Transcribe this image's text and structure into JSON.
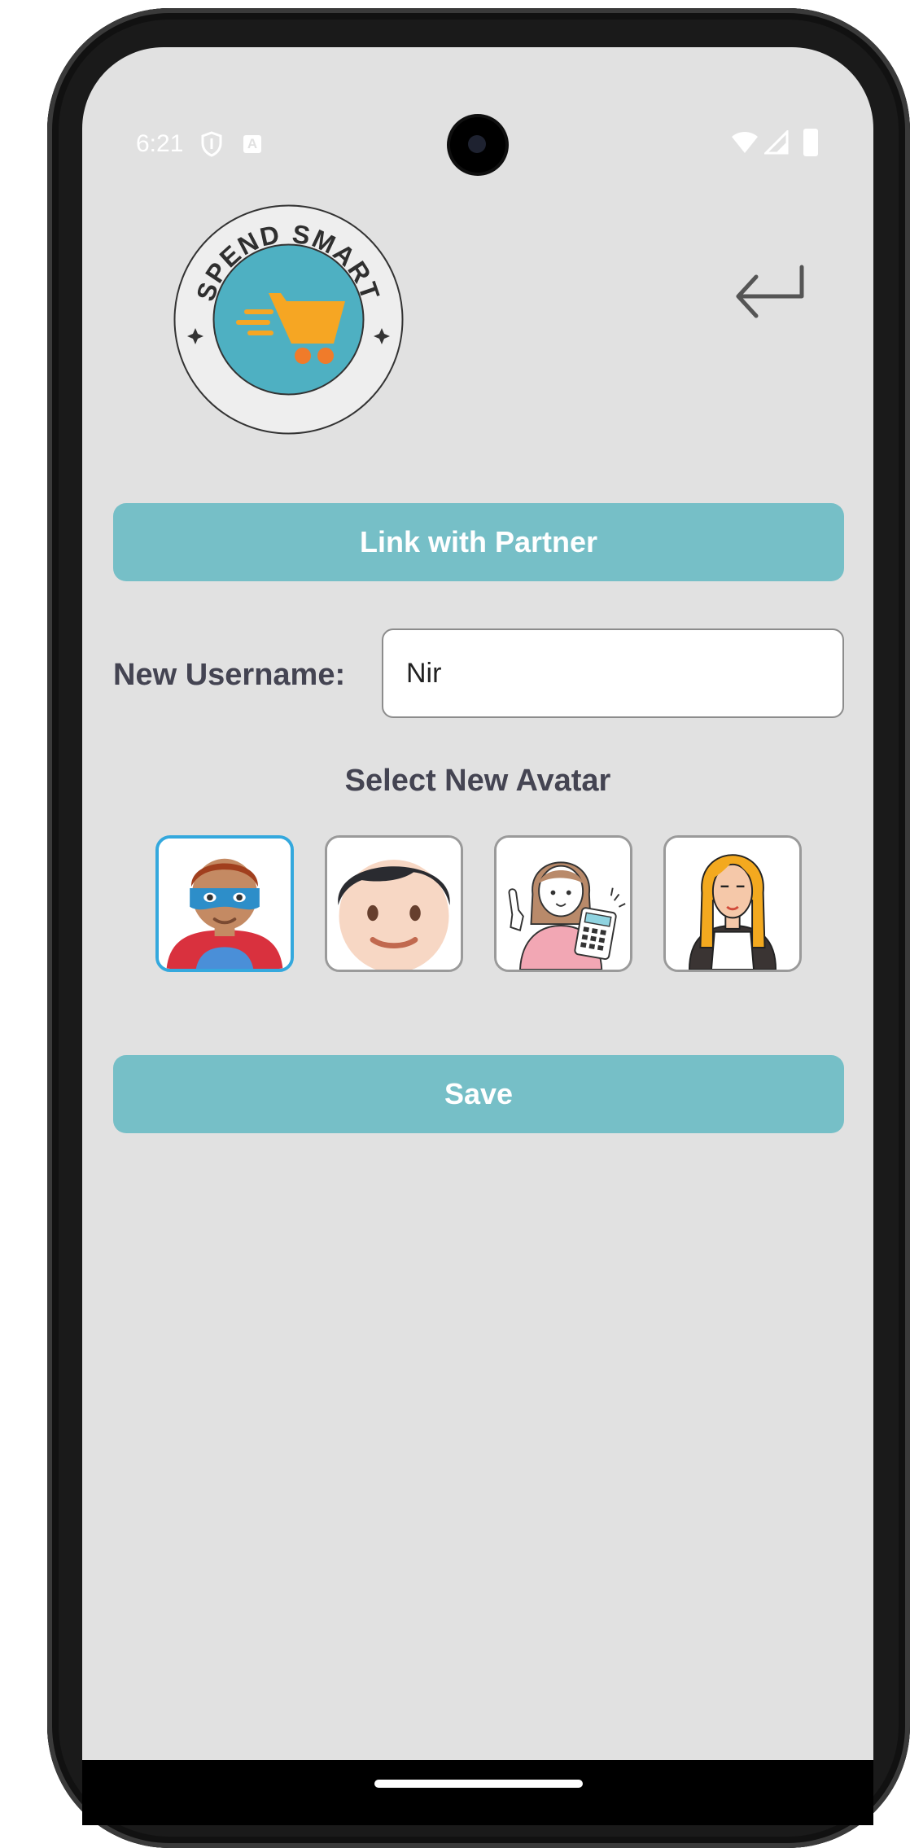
{
  "status_bar": {
    "time": "6:21",
    "notification_icons": [
      "shield-icon",
      "a-icon"
    ],
    "right_icons": [
      "wifi-icon",
      "signal-icon",
      "battery-icon"
    ]
  },
  "logo": {
    "text": "SPEND SMART",
    "icon": "shopping-cart-icon",
    "colors": {
      "ring": "#eeeeee",
      "center": "#4eb0c2",
      "cart": "#f6a623",
      "wheels": "#f07b2a"
    }
  },
  "header": {
    "back_icon": "return-arrow-icon"
  },
  "partner_button": {
    "label": "Link with Partner"
  },
  "username": {
    "label": "New Username:",
    "value": "Nir",
    "placeholder": ""
  },
  "avatar_section": {
    "title": "Select New Avatar",
    "avatars": [
      {
        "name": "superhero-avatar",
        "selected": true
      },
      {
        "name": "boy-avatar",
        "selected": false
      },
      {
        "name": "girl-calculator-avatar",
        "selected": false
      },
      {
        "name": "blonde-woman-avatar",
        "selected": false
      }
    ],
    "selected_border_color": "#34a8dd"
  },
  "save_button": {
    "label": "Save"
  },
  "colors": {
    "background": "#e1e1e1",
    "button": "#76bfc7",
    "label_text": "#444452"
  }
}
